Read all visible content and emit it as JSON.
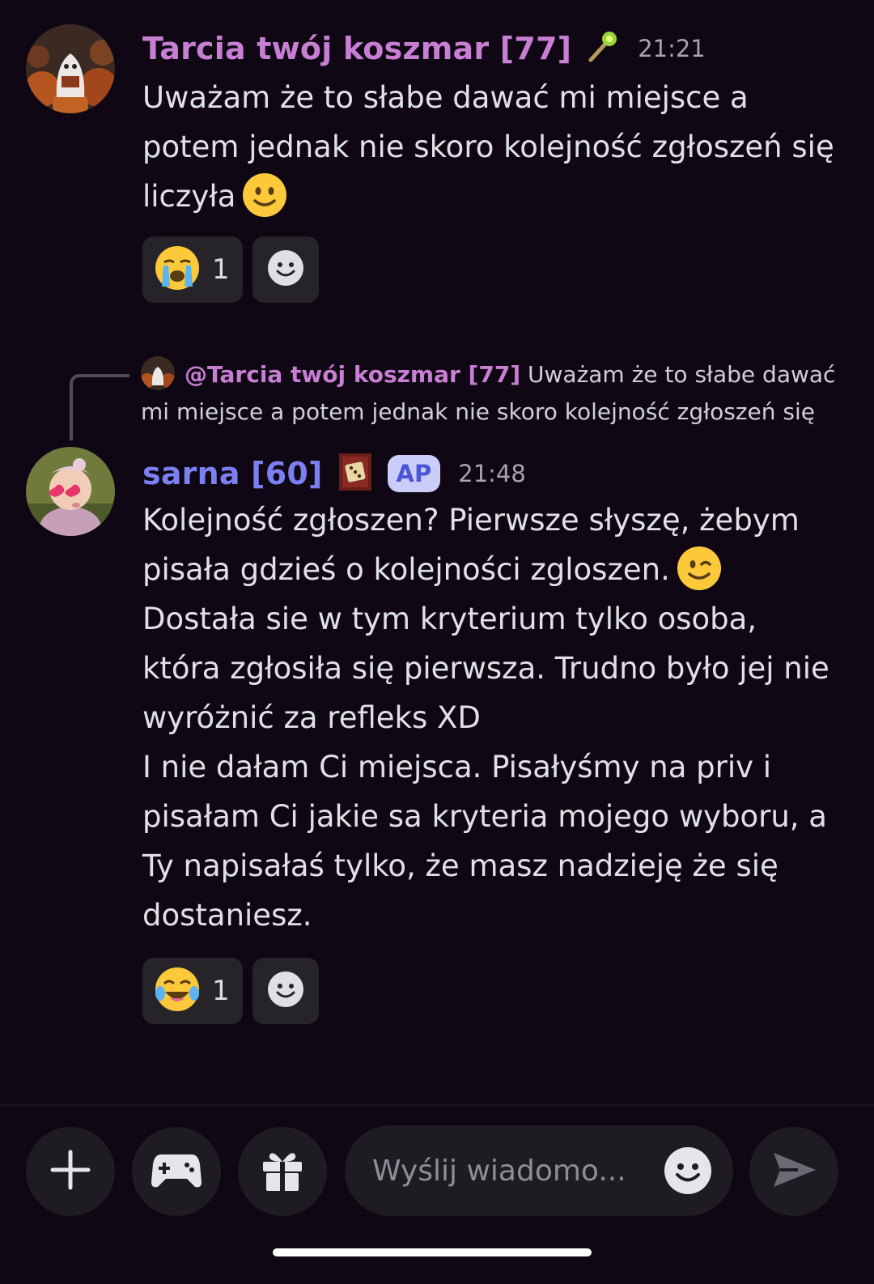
{
  "messages": [
    {
      "username": "Tarcia twój koszmar [77]",
      "username_color": "#c77ed3",
      "badge_icon": "magic-wand-icon",
      "time": "21:21",
      "avatar": "ghost-reading-avatar",
      "lines": [
        "Uważam że to słabe dawać mi miejsce a",
        "potem jednak nie skoro kolejność zgłoszeń się",
        "liczyła"
      ],
      "trailing_emoji": "slightly-smiling-face-emoji",
      "reaction": {
        "emoji": "loudly-crying-face-emoji",
        "count": "1"
      }
    },
    {
      "reply": {
        "mention": "@Tarcia twój koszmar [77]",
        "line1": " Uważam że to słabe dawać",
        "line2": "mi miejsce a potem jednak nie skoro kolejność zgłoszeń się"
      },
      "username": "sarna [60]",
      "username_color": "#7c7ff0",
      "badge_icon": "dice-icon",
      "tag": "AP",
      "time": "21:48",
      "avatar": "child-with-heart-glasses-avatar",
      "lines": [
        "Kolejność zgłoszen? Pierwsze słyszę, żebym",
        "pisała gdzieś o kolejności zgloszen.",
        "Dostała sie w tym kryterium tylko osoba,",
        "która zgłosiła się pierwsza. Trudno było jej nie",
        "wyróżnić za refleks XD",
        "I nie dałam Ci miejsca. Pisałyśmy na priv i",
        "pisałam Ci jakie sa kryteria mojego wyboru, a",
        "Ty napisałaś tylko, że masz nadzieję że się",
        "dostaniesz."
      ],
      "inline_emoji": "winking-face-emoji",
      "reaction": {
        "emoji": "face-with-tears-of-joy-emoji",
        "count": "1"
      }
    }
  ],
  "composer": {
    "placeholder": "Wyślij wiadomo...",
    "buttons": [
      "plus-icon",
      "gamepad-icon",
      "gift-icon",
      "emoji-icon",
      "send-icon"
    ]
  }
}
